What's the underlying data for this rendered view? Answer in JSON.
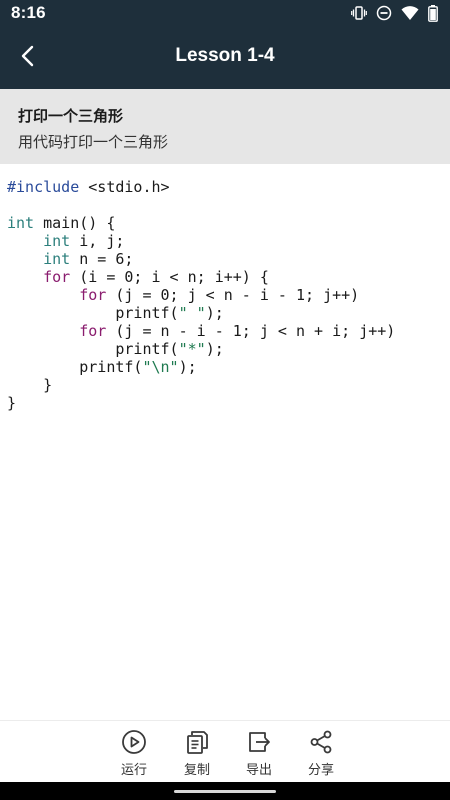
{
  "status_bar": {
    "time": "8:16",
    "icons": [
      "vibrate-icon",
      "dnd-icon",
      "wifi-icon",
      "battery-icon"
    ]
  },
  "app_bar": {
    "title": "Lesson 1-4",
    "back_icon": "chevron-left-icon"
  },
  "lesson": {
    "title": "打印一个三角形",
    "subtitle": "用代码打印一个三角形"
  },
  "code": {
    "language": "c",
    "lines": [
      "#include <stdio.h>",
      "",
      "int main() {",
      "    int i, j;",
      "    int n = 6;",
      "    for (i = 0; i < n; i++) {",
      "        for (j = 0; j < n - i - 1; j++)",
      "            printf(\" \");",
      "        for (j = n - i - 1; j < n + i; j++)",
      "            printf(\"*\");",
      "        printf(\"\\n\");",
      "    }",
      "}"
    ]
  },
  "toolbar": {
    "run_label": "运行",
    "copy_label": "复制",
    "export_label": "导出",
    "share_label": "分享",
    "icons": [
      "play-circle-icon",
      "copy-icon",
      "export-icon",
      "share-icon"
    ]
  },
  "colors": {
    "app_bar": "#1e2f3b",
    "header_bg": "#e6e6e6",
    "preprocessor": "#2a4b9a",
    "type": "#2c7f7c",
    "keyword": "#8a1c6e",
    "string": "#1f7a50"
  }
}
